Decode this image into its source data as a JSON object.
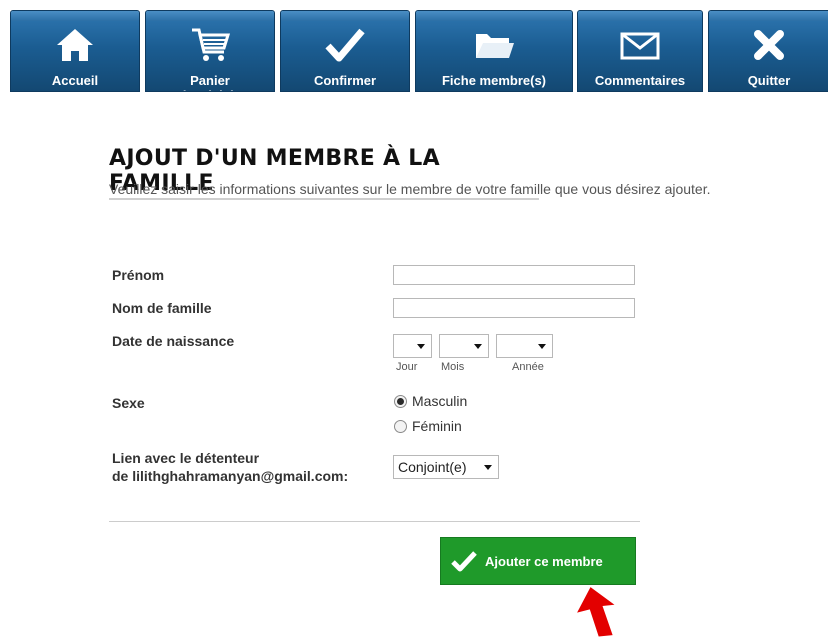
{
  "nav": {
    "tabs": [
      {
        "label": "Accueil",
        "icon": "home-icon"
      },
      {
        "label": "Panier d'activités",
        "icon": "cart-icon"
      },
      {
        "label": "Confirmer",
        "icon": "checkmark-icon"
      },
      {
        "label": "Fiche membre(s)",
        "icon": "folder-icon"
      },
      {
        "label": "Commentaires",
        "icon": "envelope-icon"
      },
      {
        "label": "Quitter",
        "icon": "close-icon"
      }
    ]
  },
  "page": {
    "title": "AJOUT D'UN MEMBRE À LA FAMILLE",
    "intro": "Veuillez saisir les informations suivantes sur le membre de votre famille que vous désirez ajouter."
  },
  "form": {
    "first_name": {
      "label": "Prénom",
      "value": ""
    },
    "last_name": {
      "label": "Nom de famille",
      "value": ""
    },
    "birthdate": {
      "label": "Date de naissance",
      "day_label": "Jour",
      "day_value": "",
      "month_label": "Mois",
      "month_value": "",
      "year_label": "Année",
      "year_value": ""
    },
    "sex": {
      "label": "Sexe",
      "options": [
        "Masculin",
        "Féminin"
      ],
      "selected": "Masculin"
    },
    "relation": {
      "label_line1": "Lien avec le détenteur",
      "label_line2": "de lilithghahramanyan@gmail.com:",
      "value": "Conjoint(e)"
    },
    "submit_label": "Ajouter ce membre"
  },
  "colors": {
    "nav_blue": "#1b5d92",
    "submit_green": "#1f9a2a",
    "annotation_arrow": "#e30000"
  }
}
